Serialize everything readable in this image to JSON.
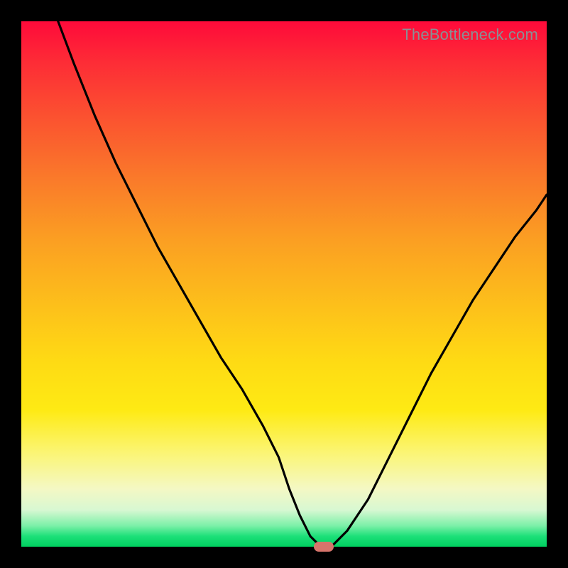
{
  "watermark": "TheBottleneck.com",
  "colors": {
    "curve_stroke": "#000000",
    "marker_fill": "#d7746b",
    "frame_bg": "#000000"
  },
  "chart_data": {
    "type": "line",
    "title": "",
    "xlabel": "",
    "ylabel": "",
    "xlim": [
      0,
      100
    ],
    "ylim": [
      0,
      100
    ],
    "grid": false,
    "legend": false,
    "series": [
      {
        "name": "curve",
        "x": [
          7,
          10,
          14,
          18,
          22,
          26,
          30,
          34,
          38,
          42,
          46,
          49,
          51,
          53,
          55,
          57,
          59,
          62,
          66,
          70,
          74,
          78,
          82,
          86,
          90,
          94,
          98,
          100
        ],
        "y": [
          100,
          92,
          82,
          73,
          65,
          57,
          50,
          43,
          36,
          30,
          23,
          17,
          11,
          6,
          2,
          0,
          0,
          3,
          9,
          17,
          25,
          33,
          40,
          47,
          53,
          59,
          64,
          67
        ]
      }
    ],
    "marker": {
      "x": 57.5,
      "y": 0
    },
    "background_gradient": {
      "direction": "top-to-bottom",
      "stops": [
        {
          "pos": 0,
          "color": "#ff0a3a"
        },
        {
          "pos": 18,
          "color": "#fb5130"
        },
        {
          "pos": 42,
          "color": "#fba022"
        },
        {
          "pos": 65,
          "color": "#fedb14"
        },
        {
          "pos": 89,
          "color": "#f4f8c4"
        },
        {
          "pos": 96,
          "color": "#7cf0a8"
        },
        {
          "pos": 100,
          "color": "#00d060"
        }
      ]
    }
  }
}
